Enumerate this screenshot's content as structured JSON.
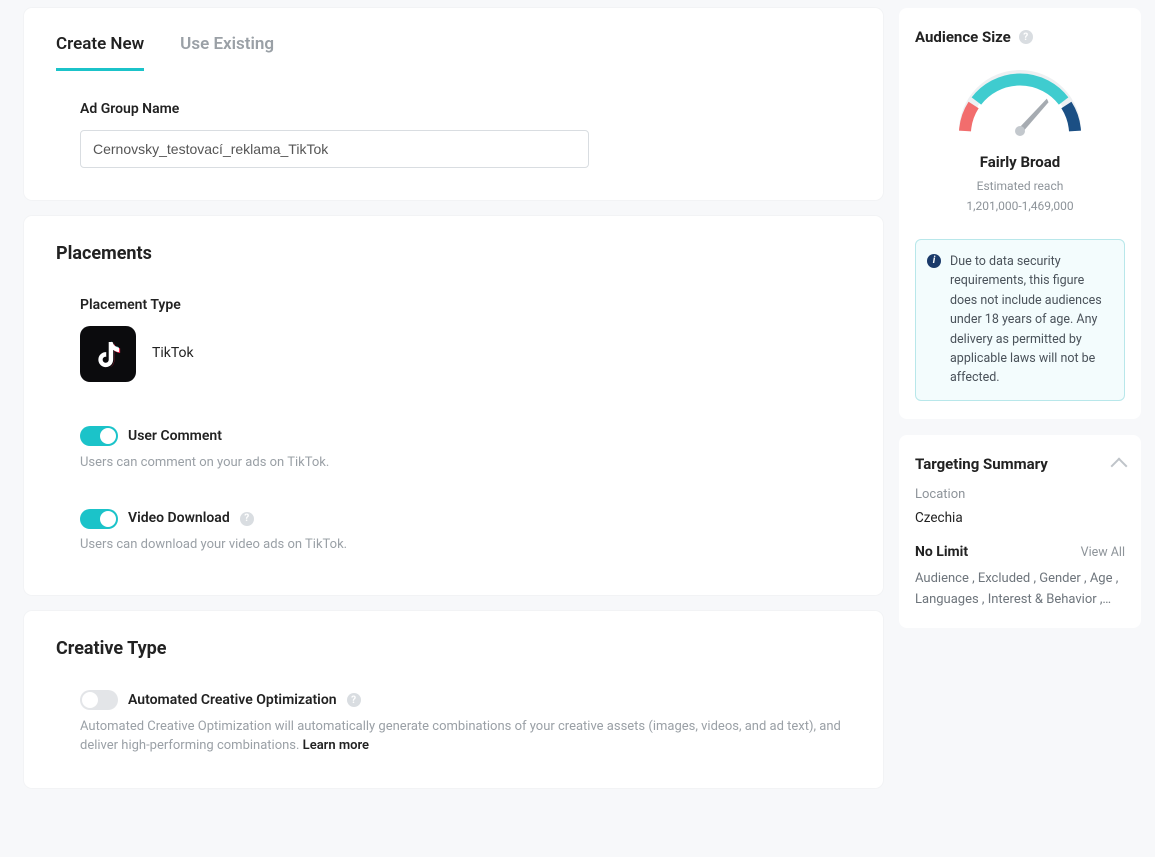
{
  "tabs": {
    "create_new": "Create New",
    "use_existing": "Use Existing"
  },
  "ad_group": {
    "name_label": "Ad Group Name",
    "name_value": "Cernovsky_testovací_reklama_TikTok"
  },
  "placements": {
    "title": "Placements",
    "type_label": "Placement Type",
    "tiktok_label": "TikTok",
    "user_comment": {
      "label": "User Comment",
      "hint": "Users can comment on your ads on TikTok.",
      "on": true
    },
    "video_download": {
      "label": "Video Download",
      "hint": "Users can download your video ads on TikTok.",
      "on": true
    }
  },
  "creative": {
    "title": "Creative Type",
    "aco": {
      "label": "Automated Creative Optimization",
      "hint_prefix": "Automated Creative Optimization will automatically generate combinations of your creative assets (images, videos, and ad text), and deliver high-performing combinations. ",
      "learn_more": "Learn more",
      "on": false
    }
  },
  "audience": {
    "title": "Audience Size",
    "gauge_label": "Fairly Broad",
    "estimated_label": "Estimated reach",
    "reach_range": "1,201,000-1,469,000",
    "notice": "Due to data security requirements, this figure does not include audiences under 18 years of age. Any delivery as permitted by applicable laws will not be affected."
  },
  "targeting": {
    "title": "Targeting Summary",
    "location_label": "Location",
    "location_value": "Czechia",
    "no_limit": "No Limit",
    "view_all": "View All",
    "tags": "Audience , Excluded , Gender , Age , Languages , Interest & Behavior ,…"
  }
}
